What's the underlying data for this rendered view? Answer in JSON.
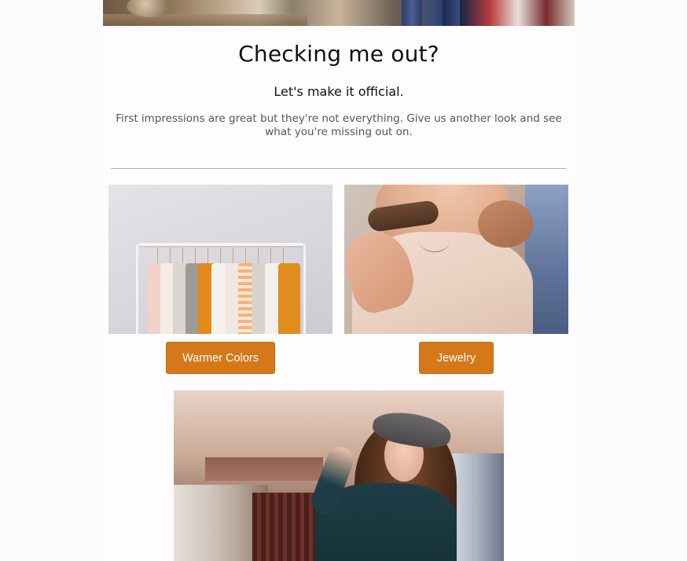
{
  "email": {
    "heading": "Checking me out?",
    "subheading": "Let's make it official.",
    "body": "First impressions are great but they're not everything. Give us another look and see what you're missing out on."
  },
  "products": [
    {
      "button_label": "Warmer Colors",
      "image": "clothing-rack-image"
    },
    {
      "button_label": "Jewelry",
      "image": "necklace-image"
    }
  ],
  "colors": {
    "button": "#d4781a",
    "divider": "#b3b3b3",
    "background": "#fcfbfb"
  }
}
